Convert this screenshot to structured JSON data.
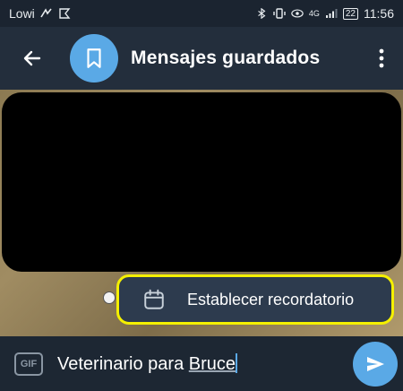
{
  "status_bar": {
    "carrier": "Lowi",
    "network_label": "4G",
    "battery": "22",
    "time": "11:56"
  },
  "header": {
    "title": "Mensajes guardados",
    "back_icon": "arrow-left-icon",
    "avatar_icon": "bookmark-icon",
    "menu_icon": "more-vertical-icon"
  },
  "popup": {
    "label": "Establecer recordatorio",
    "icon": "calendar-icon",
    "highlight_color": "#f5f000"
  },
  "composer": {
    "gif_label": "GIF",
    "text_plain": "Veterinario para ",
    "text_underlined": "Bruce",
    "send_icon": "send-icon"
  },
  "colors": {
    "accent": "#5aa9e6",
    "header_bg": "#232e3c",
    "popup_bg": "#2d3b4e"
  }
}
